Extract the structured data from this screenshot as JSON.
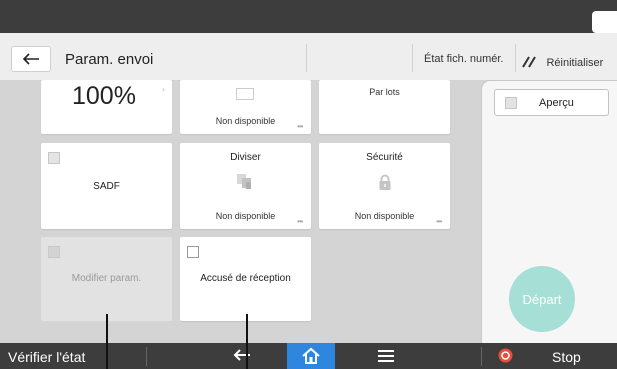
{
  "header": {
    "title": "Param. envoi",
    "file_status_label": "État fich. numér.",
    "reset_label": "Réinitialiser"
  },
  "tiles": {
    "scale_value": "100%",
    "top_middle_sub": "Non disponible",
    "batch_label": "Par lots",
    "sadf_label": "SADF",
    "divide_label": "Diviser",
    "divide_sub": "Non disponible",
    "security_label": "Sécurité",
    "security_sub": "Non disponible",
    "modify_params_label": "Modifier param.",
    "read_receipt_label": "Accusé de réception"
  },
  "side_panel": {
    "preview_label": "Aperçu",
    "start_label": "Départ"
  },
  "bottom_bar": {
    "check_status_label": "Vérifier l'état",
    "stop_label": "Stop"
  },
  "colors": {
    "status_bar": "#3d3d3d",
    "content_bg": "#d4d4d4",
    "start_button": "#a6dfd5",
    "home_tab": "#2e86de",
    "stop_icon": "#e74c3c"
  },
  "icons": [
    "moon-icon",
    "back-arrow-icon",
    "edit-icon",
    "divide-icon",
    "lock-icon",
    "home-icon",
    "menu-icon",
    "stop-icon"
  ]
}
